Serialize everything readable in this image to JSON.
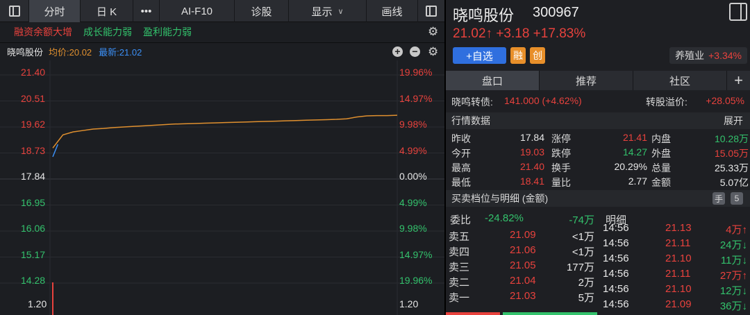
{
  "toolbar": {
    "tabs": [
      "分时",
      "日 K",
      "•••",
      "AI-F10",
      "诊股",
      "显示",
      "画线"
    ],
    "display_chev": "∨"
  },
  "tags": [
    "融资余额大增",
    "成长能力弱",
    "盈利能力弱"
  ],
  "chart_header": {
    "name": "晓鸣股份",
    "avg": "均价:20.02",
    "latest": "最新:21.02",
    "plus": "+",
    "minus": "−"
  },
  "chart_data": {
    "type": "line",
    "y_left_ticks": [
      "21.40",
      "20.51",
      "19.62",
      "18.73",
      "17.84",
      "16.95",
      "16.06",
      "15.17",
      "14.28"
    ],
    "y_right_ticks": [
      "19.96%",
      "14.97%",
      "9.98%",
      "4.99%",
      "0.00%",
      "4.99%",
      "9.98%",
      "14.97%",
      "19.96%"
    ],
    "volume_tick_left": "1.20",
    "volume_tick_right": "1.20",
    "ylim": [
      14.28,
      21.4
    ],
    "prev_close": 17.84,
    "series": [
      {
        "name": "最新",
        "values": [
          18.6,
          19.45,
          19.7,
          19.8,
          19.9,
          20.2,
          20.4,
          20.3,
          20.1,
          20.4,
          20.6,
          20.5,
          20.7,
          20.55,
          20.35,
          20.45,
          20.5,
          20.3,
          20.45,
          20.35,
          20.4,
          20.5,
          20.45,
          20.6,
          20.55,
          20.4,
          20.45,
          20.45,
          20.5,
          20.9,
          21.35,
          21.1,
          21.15,
          21.1,
          21.02
        ]
      },
      {
        "name": "均价",
        "values": [
          18.9,
          19.35,
          19.45,
          19.5,
          19.55,
          19.57,
          19.6,
          19.62,
          19.64,
          19.66,
          19.68,
          19.7,
          19.72,
          19.73,
          19.74,
          19.75,
          19.76,
          19.77,
          19.78,
          19.79,
          19.8,
          19.81,
          19.82,
          19.83,
          19.84,
          19.85,
          19.86,
          19.87,
          19.88,
          19.9,
          19.96,
          20.0,
          20.01,
          20.01,
          20.02
        ]
      }
    ],
    "colors": {
      "price": "#3b8ff5",
      "avg": "#e0902f"
    }
  },
  "stock": {
    "name": "晓鸣股份",
    "code": "300967",
    "price_line": "21.02↑ +3.18 +17.83%",
    "add_watch": "+自选",
    "badge1": "融",
    "badge2": "创",
    "industry_label": "养殖业",
    "industry_change": "+3.34%"
  },
  "right_tabs": [
    "盘口",
    "推荐",
    "社区",
    "+"
  ],
  "bond": {
    "label": "晓鸣转债:",
    "value": "141.000 (+4.62%)",
    "premium_label": "转股溢价:",
    "premium_value": "+28.05%"
  },
  "quote_section": {
    "title": "行情数据",
    "expand": "展开"
  },
  "quote_rows": [
    [
      {
        "k": "昨收",
        "v": "17.84",
        "c": "white"
      },
      {
        "k": "涨停",
        "v": "21.41",
        "c": "red"
      },
      {
        "k": "内盘",
        "v": "10.28万",
        "c": "green"
      }
    ],
    [
      {
        "k": "今开",
        "v": "19.03",
        "c": "red"
      },
      {
        "k": "跌停",
        "v": "14.27",
        "c": "green"
      },
      {
        "k": "外盘",
        "v": "15.05万",
        "c": "red"
      }
    ],
    [
      {
        "k": "最高",
        "v": "21.40",
        "c": "red"
      },
      {
        "k": "换手",
        "v": "20.29%",
        "c": "white"
      },
      {
        "k": "总量",
        "v": "25.33万",
        "c": "white"
      }
    ],
    [
      {
        "k": "最低",
        "v": "18.41",
        "c": "red"
      },
      {
        "k": "量比",
        "v": "2.77",
        "c": "white"
      },
      {
        "k": "金额",
        "v": "5.07亿",
        "c": "white"
      }
    ]
  ],
  "ob_section": {
    "title": "买卖档位与明细 (金额)",
    "hand": "手",
    "five": "5"
  },
  "weibi": {
    "label": "委比",
    "pct": "-24.82%",
    "amt": "-74万"
  },
  "detail_title": "明细",
  "orderbook": [
    {
      "k": "卖五",
      "p": "21.09",
      "v": "<1万"
    },
    {
      "k": "卖四",
      "p": "21.06",
      "v": "<1万"
    },
    {
      "k": "卖三",
      "p": "21.05",
      "v": "177万"
    },
    {
      "k": "卖二",
      "p": "21.04",
      "v": "2万"
    },
    {
      "k": "卖一",
      "p": "21.03",
      "v": "5万"
    }
  ],
  "details": [
    {
      "t": "14:56",
      "p": "21.13",
      "v": "4万↑",
      "c": "red"
    },
    {
      "t": "14:56",
      "p": "21.11",
      "v": "24万↓",
      "c": "green"
    },
    {
      "t": "14:56",
      "p": "21.10",
      "v": "11万↓",
      "c": "green"
    },
    {
      "t": "14:56",
      "p": "21.11",
      "v": "27万↑",
      "c": "red"
    },
    {
      "t": "14:56",
      "p": "21.10",
      "v": "12万↓",
      "c": "green"
    },
    {
      "t": "14:56",
      "p": "21.09",
      "v": "36万↓",
      "c": "green"
    }
  ]
}
